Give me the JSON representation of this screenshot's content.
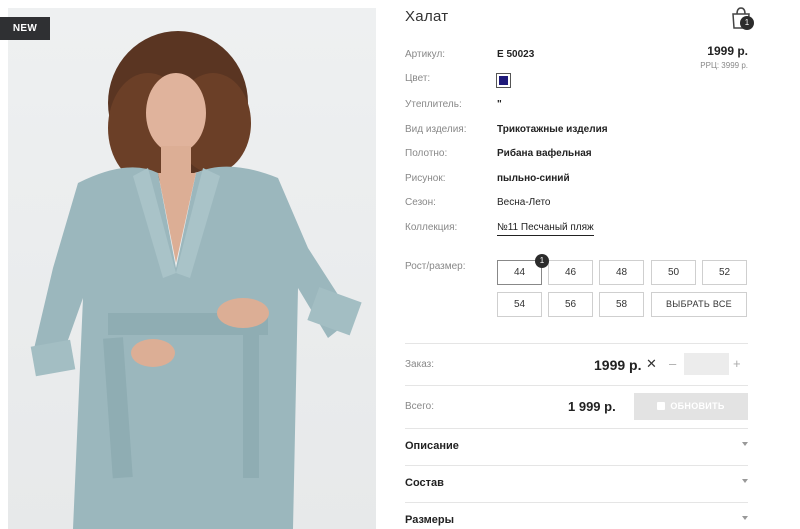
{
  "badge": "NEW",
  "product": {
    "title": "Халат",
    "cart_count": "1",
    "price": "1999 р.",
    "rrp": "РРЦ: 3999 р."
  },
  "specs": [
    {
      "label": "Артикул:",
      "value": "Е 50023"
    },
    {
      "label": "Цвет:",
      "value": ""
    },
    {
      "label": "Утеплитель:",
      "value": "\""
    },
    {
      "label": "Вид изделия:",
      "value": "Трикотажные изделия"
    },
    {
      "label": "Полотно:",
      "value": "Рибана вафельная"
    },
    {
      "label": "Рисунок:",
      "value": "пыльно-синий"
    },
    {
      "label": "Сезон:",
      "value": "Весна-Лето"
    },
    {
      "label": "Коллекция:",
      "value": "№11 Песчаный пляж"
    }
  ],
  "color_swatch": "#1f1a7a",
  "sizes": {
    "label": "Рост/размер:",
    "row1": [
      "44",
      "46",
      "48",
      "50",
      "52"
    ],
    "row2": [
      "54",
      "56",
      "58"
    ],
    "select_all": "ВЫБРАТЬ ВСЕ",
    "selected_badge": "1"
  },
  "order": {
    "label": "Заказ:",
    "price": "1999 р.",
    "times": "✕",
    "minus": "–",
    "plus": "+",
    "qty_value": ""
  },
  "total": {
    "label": "Всего:",
    "value": "1 999 р.",
    "button": "ОБНОВИТЬ"
  },
  "accordion": [
    "Описание",
    "Состав",
    "Размеры"
  ]
}
